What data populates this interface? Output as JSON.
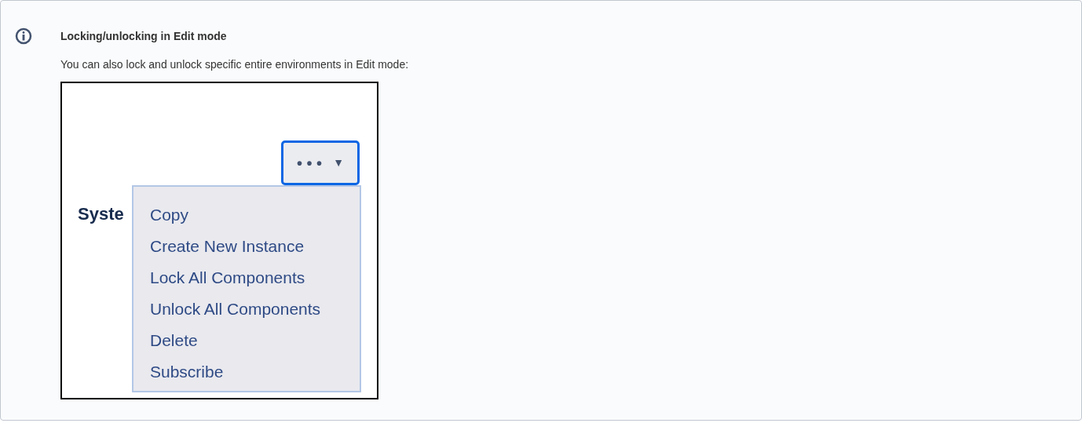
{
  "info_panel": {
    "title": "Locking/unlocking in Edit mode",
    "text": "You can also lock and unlock specific entire environments in Edit mode:",
    "screenshot": {
      "more_button": {
        "label": "• • •",
        "caret": "▼",
        "expanded": true
      },
      "heading": "Syste",
      "menu": [
        {
          "label": "Copy"
        },
        {
          "label": "Create New Instance"
        },
        {
          "label": "Lock All Components"
        },
        {
          "label": "Unlock All Components"
        },
        {
          "label": "Delete"
        },
        {
          "label": "Subscribe"
        }
      ]
    }
  }
}
